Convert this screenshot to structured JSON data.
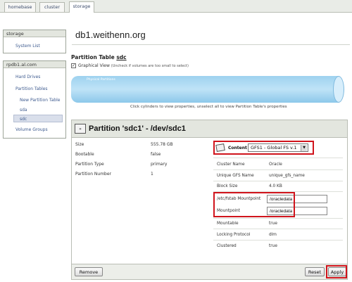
{
  "tabs": [
    {
      "label": "homebase",
      "active": false
    },
    {
      "label": "cluster",
      "active": false
    },
    {
      "label": "storage",
      "active": true
    }
  ],
  "sidebar": {
    "storage_box": {
      "header": "storage",
      "items": [
        "System List"
      ]
    },
    "system_box": {
      "header": "rpdb1.al.com",
      "items": [
        "Hard Drives",
        "Partition Tables",
        "New Partition Table",
        "sda",
        "sdc",
        "Volume Groups"
      ],
      "selected": "sdc"
    }
  },
  "host_title": "db1.weithenn.org",
  "partition_table": {
    "label": "Partition Table",
    "device": "sdc",
    "graphical_view_label": "Graphical View",
    "graphical_view_hint": "(Uncheck if volumes are too small to select)",
    "graphical_view_checked": true,
    "cylinder_label": "Physical Partitions",
    "instructions": "Click cylinders to view properties, unselect all to view Partition Table's properties"
  },
  "partition": {
    "title": "Partition 'sdc1' - /dev/sdc1",
    "properties": [
      {
        "label": "Size",
        "value": "555.78 GB"
      },
      {
        "label": "Bootable",
        "value": "false"
      },
      {
        "label": "Partition Type",
        "value": "primary"
      },
      {
        "label": "Partition Number",
        "value": "1"
      }
    ],
    "content": {
      "label": "Content",
      "selected": "GFS1 - Global FS v.1",
      "fields": [
        {
          "label": "Cluster Name",
          "value": "Oracle"
        },
        {
          "label": "Unique GFS Name",
          "value": "unique_gfs_name"
        },
        {
          "label": "Block Size",
          "value": "4.0 KB"
        }
      ],
      "fstab_mountpoint_label": "/etc/fstab Mountpoint",
      "fstab_mountpoint_value": "/oracledata",
      "mountpoint_label": "Mountpoint",
      "mountpoint_value": "/oracledata",
      "more_fields": [
        {
          "label": "Mountable",
          "value": "true"
        },
        {
          "label": "Locking Protocol",
          "value": "dlm"
        },
        {
          "label": "Clustered",
          "value": "true"
        }
      ]
    },
    "buttons": {
      "remove": "Remove",
      "reset": "Reset",
      "apply": "Apply"
    }
  },
  "colors": {
    "highlight": "#d0141c",
    "link": "#3e5b8f",
    "cylinder": "#9ed2ef"
  }
}
